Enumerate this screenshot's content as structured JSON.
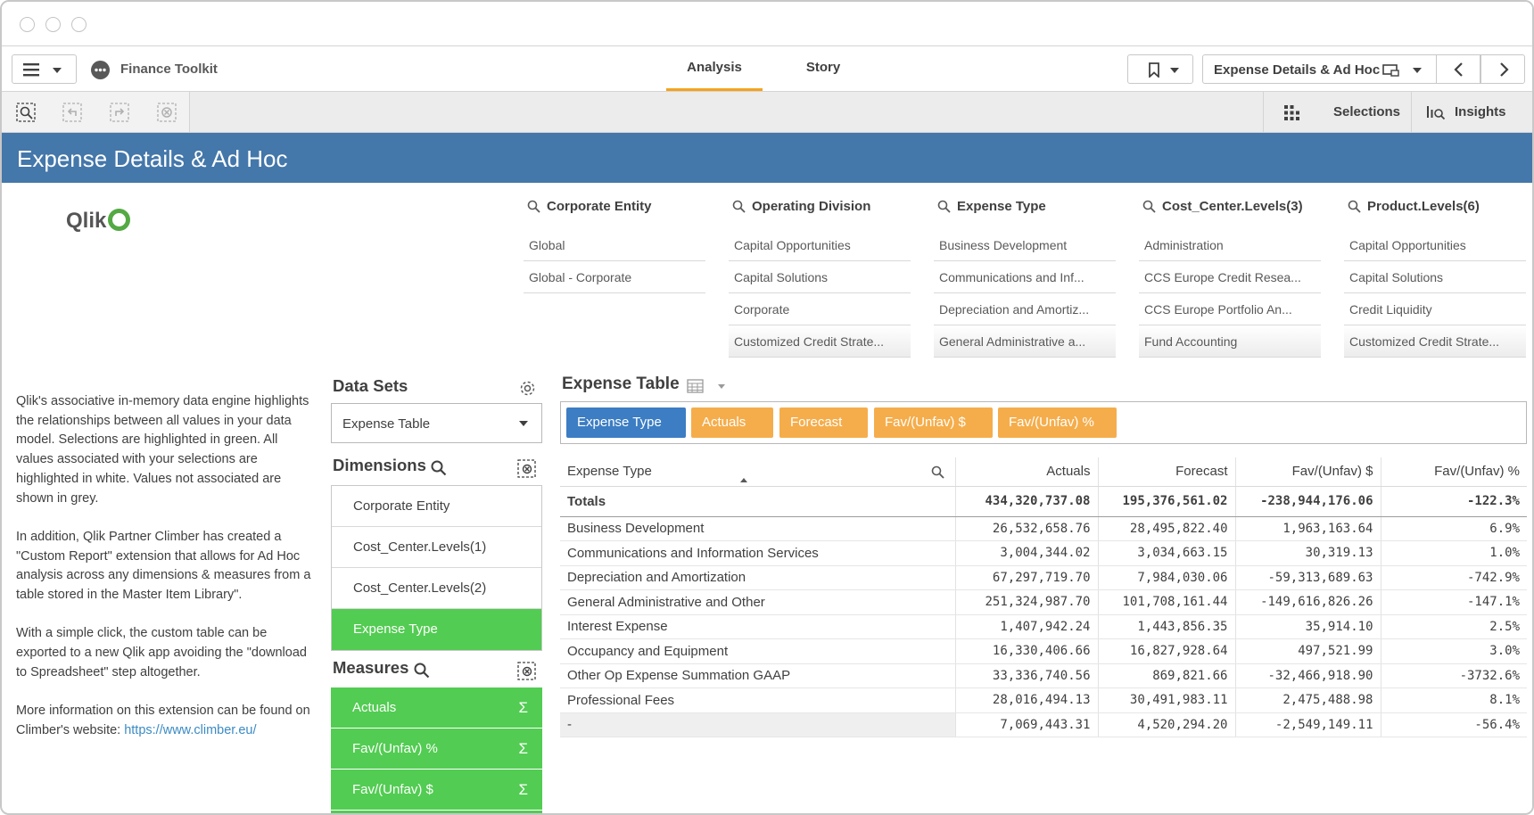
{
  "app": {
    "name": "Finance Toolkit"
  },
  "nav": {
    "tabs": [
      {
        "label": "Analysis",
        "active": true
      },
      {
        "label": "Story",
        "active": false
      }
    ],
    "sheet_selector": "Expense Details & Ad Hoc"
  },
  "toolbar": {
    "selections_label": "Selections",
    "insights_label": "Insights"
  },
  "sheet": {
    "title": "Expense Details & Ad Hoc"
  },
  "logo": {
    "text": "Qlik"
  },
  "filters": [
    {
      "title": "Corporate Entity",
      "items": [
        "Global",
        "Global - Corporate"
      ]
    },
    {
      "title": "Operating Division",
      "items": [
        "Capital Opportunities",
        "Capital Solutions",
        "Corporate",
        "Customized Credit Strate..."
      ]
    },
    {
      "title": "Expense Type",
      "items": [
        "Business Development",
        "Communications and Inf...",
        "Depreciation and Amortiz...",
        "General Administrative a..."
      ]
    },
    {
      "title": "Cost_Center.Levels(3)",
      "items": [
        "Administration",
        "CCS Europe Credit Resea...",
        "CCS Europe Portfolio An...",
        "Fund Accounting"
      ]
    },
    {
      "title": "Product.Levels(6)",
      "items": [
        "Capital Opportunities",
        "Capital Solutions",
        "Credit Liquidity",
        "Customized Credit Strate..."
      ]
    }
  ],
  "description": {
    "p1": "Qlik's associative in-memory data engine highlights the relationships between all values in your data model. Selections are highlighted in green. All values associated with your selections are highlighted in white. Values not associated are shown in grey.",
    "p2": "In addition, Qlik Partner Climber has created a \"Custom Report\" extension that allows for Ad Hoc analysis across any dimensions & measures from a table stored in the Master Item Library\".",
    "p3": "With a simple click, the custom table can be exported to a new Qlik app avoiding the \"download to Spreadsheet\" step altogether.",
    "p4": "More information on this extension can be found on Climber's website: ",
    "link": "https://www.climber.eu/"
  },
  "datasets": {
    "title": "Data Sets",
    "selected": "Expense Table"
  },
  "dimensions": {
    "title": "Dimensions",
    "items": [
      {
        "label": "Corporate Entity",
        "selected": false
      },
      {
        "label": "Cost_Center.Levels(1)",
        "selected": false
      },
      {
        "label": "Cost_Center.Levels(2)",
        "selected": false
      },
      {
        "label": "Expense Type",
        "selected": true
      }
    ]
  },
  "measures": {
    "title": "Measures",
    "items": [
      {
        "label": "Actuals",
        "symbol": "Σ"
      },
      {
        "label": "Fav/(Unfav) %",
        "symbol": "Σ"
      },
      {
        "label": "Fav/(Unfav) $",
        "symbol": "Σ"
      }
    ]
  },
  "expense_table": {
    "title": "Expense Table",
    "chips": [
      {
        "label": "Expense Type",
        "kind": "dimension"
      },
      {
        "label": "Actuals",
        "kind": "measure"
      },
      {
        "label": "Forecast",
        "kind": "measure"
      },
      {
        "label": "Fav/(Unfav) $",
        "kind": "measure"
      },
      {
        "label": "Fav/(Unfav) %",
        "kind": "measure"
      }
    ],
    "columns": [
      "Expense Type",
      "Actuals",
      "Forecast",
      "Fav/(Unfav) $",
      "Fav/(Unfav) %"
    ],
    "totals": [
      "Totals",
      "434,320,737.08",
      "195,376,561.02",
      "-238,944,176.06",
      "-122.3%"
    ],
    "rows": [
      [
        "Business Development",
        "26,532,658.76",
        "28,495,822.40",
        "1,963,163.64",
        "6.9%"
      ],
      [
        "Communications and Information Services",
        "3,004,344.02",
        "3,034,663.15",
        "30,319.13",
        "1.0%"
      ],
      [
        "Depreciation and Amortization",
        "67,297,719.70",
        "7,984,030.06",
        "-59,313,689.63",
        "-742.9%"
      ],
      [
        "General Administrative and Other",
        "251,324,987.70",
        "101,708,161.44",
        "-149,616,826.26",
        "-147.1%"
      ],
      [
        "Interest Expense",
        "1,407,942.24",
        "1,443,856.35",
        "35,914.10",
        "2.5%"
      ],
      [
        "Occupancy and Equipment",
        "16,330,406.66",
        "16,827,928.64",
        "497,521.99",
        "3.0%"
      ],
      [
        "Other Op Expense Summation GAAP",
        "33,336,740.56",
        "869,821.66",
        "-32,466,918.90",
        "-3732.6%"
      ],
      [
        "Professional Fees",
        "28,016,494.13",
        "30,491,983.11",
        "2,475,488.98",
        "8.1%"
      ],
      [
        "-",
        "7,069,443.31",
        "4,520,294.20",
        "-2,549,149.11",
        "-56.4%"
      ]
    ]
  },
  "colors": {
    "header_blue": "#4477aa",
    "selected_green": "#52cc52",
    "chip_blue": "#3c7dc3",
    "chip_orange": "#f5ad4b",
    "tab_underline": "#f5a21b"
  }
}
